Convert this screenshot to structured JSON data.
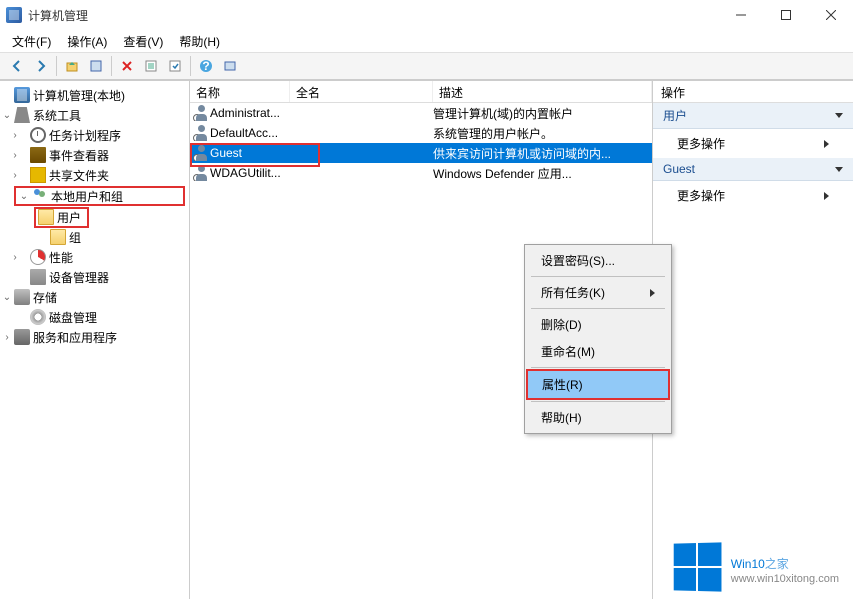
{
  "title": "计算机管理",
  "menus": {
    "file": "文件(F)",
    "action": "操作(A)",
    "view": "查看(V)",
    "help": "帮助(H)"
  },
  "tree": {
    "root": "计算机管理(本地)",
    "system_tools": "系统工具",
    "task_scheduler": "任务计划程序",
    "event_viewer": "事件查看器",
    "shared_folders": "共享文件夹",
    "local_users_groups": "本地用户和组",
    "users": "用户",
    "groups": "组",
    "performance": "性能",
    "device_manager": "设备管理器",
    "storage": "存储",
    "disk_management": "磁盘管理",
    "services_apps": "服务和应用程序"
  },
  "columns": {
    "name": "名称",
    "full_name": "全名",
    "description": "描述"
  },
  "users": [
    {
      "name": "Administrat...",
      "full": "",
      "desc": "管理计算机(域)的内置帐户"
    },
    {
      "name": "DefaultAcc...",
      "full": "",
      "desc": "系统管理的用户帐户。"
    },
    {
      "name": "Guest",
      "full": "",
      "desc": "供来宾访问计算机或访问域的内..."
    },
    {
      "name": "WDAGUtilit...",
      "full": "",
      "desc": "Windows Defender 应用..."
    }
  ],
  "context": {
    "set_password": "设置密码(S)...",
    "all_tasks": "所有任务(K)",
    "delete": "删除(D)",
    "rename": "重命名(M)",
    "properties": "属性(R)",
    "help": "帮助(H)"
  },
  "actions": {
    "header": "操作",
    "users_group": "用户",
    "more_actions": "更多操作",
    "guest_group": "Guest"
  },
  "watermark": {
    "brand_a": "Win10",
    "brand_b": "之家",
    "url": "www.win10xitong.com"
  }
}
